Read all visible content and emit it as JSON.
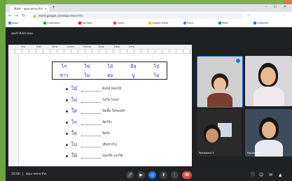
{
  "colors": {
    "accent": "#1a73e8",
    "end_call": "#ea4335",
    "slide_text": "#2a2aa0"
  },
  "browser": {
    "tab_title": "Meet - wpu-eonv-ihn",
    "tab_close": "×",
    "new_tab": "+",
    "window_controls": "– ☐ ✕",
    "back": "←",
    "forward": "→",
    "reload": "↻",
    "url": "meet.google.com/wpu-eonv-ihn",
    "lock_icon": "🔒",
    "star_icon": "☆",
    "menu_icon": "⋮",
    "bookmarks": [
      {
        "label": "Apps",
        "color": "#4285f4"
      },
      {
        "label": "Classroom",
        "color": "#0f9d58"
      },
      {
        "label": "YouTube",
        "color": "#ff0000"
      },
      {
        "label": "Gmail",
        "color": "#ea4335"
      },
      {
        "label": "Google Drive",
        "color": "#fbbc05"
      },
      {
        "label": "Docs",
        "color": "#4285f4"
      },
      {
        "label": "Meet",
        "color": "#00897b"
      },
      {
        "label": "Calendar",
        "color": "#1a73e8"
      }
    ]
  },
  "meet": {
    "presenting_label": "คุณกำลังนำเสนอ",
    "slide_toolbar": [
      "File",
      "Edit",
      "View",
      "Insert",
      "Format",
      "Tools",
      "Table",
      "Help"
    ],
    "table": {
      "rows": [
        [
          "ไก่",
          "ไข่",
          "ไม้",
          "มือ",
          "ไป"
        ],
        [
          "ขาว",
          "ไม่",
          "ดม",
          "ปู",
          "ไม่"
        ]
      ]
    },
    "vocab": [
      {
        "word": "ไม้",
        "meaning": "ต้นไม้ ท่อนไม้"
      },
      {
        "word": "ไม่",
        "meaning": "ไม่ใช่ ไม่เอา"
      },
      {
        "word": "ใส่",
        "meaning": "ใส่เสื้อ ใส่รองเท้า"
      },
      {
        "word": "ไก่",
        "meaning": "สัตว์ปีก"
      },
      {
        "word": "ใจ",
        "meaning": "จิตใจ"
      },
      {
        "word": "ไป",
        "meaning": "เดินทางไป"
      },
      {
        "word": "ให้",
        "meaning": "มอบให้ แจกให้"
      }
    ],
    "participants": [
      {
        "name": "",
        "bg": "#cfcfcf"
      },
      {
        "name": "",
        "bg": "#d8d8dc"
      },
      {
        "name": "Participant 3",
        "bg": "#2a2a2a"
      },
      {
        "name": "Participant 4",
        "bg": "#3d4b5c"
      }
    ],
    "bottom": {
      "time": "10:00",
      "meeting_code": "wpu-eonv-ihn",
      "controls": [
        "mic-icon",
        "camera-icon",
        "captions-icon",
        "present-icon",
        "more-icon",
        "end-call-icon"
      ],
      "right_icons": [
        "info-icon",
        "people-icon",
        "chat-icon",
        "activities-icon"
      ]
    }
  }
}
